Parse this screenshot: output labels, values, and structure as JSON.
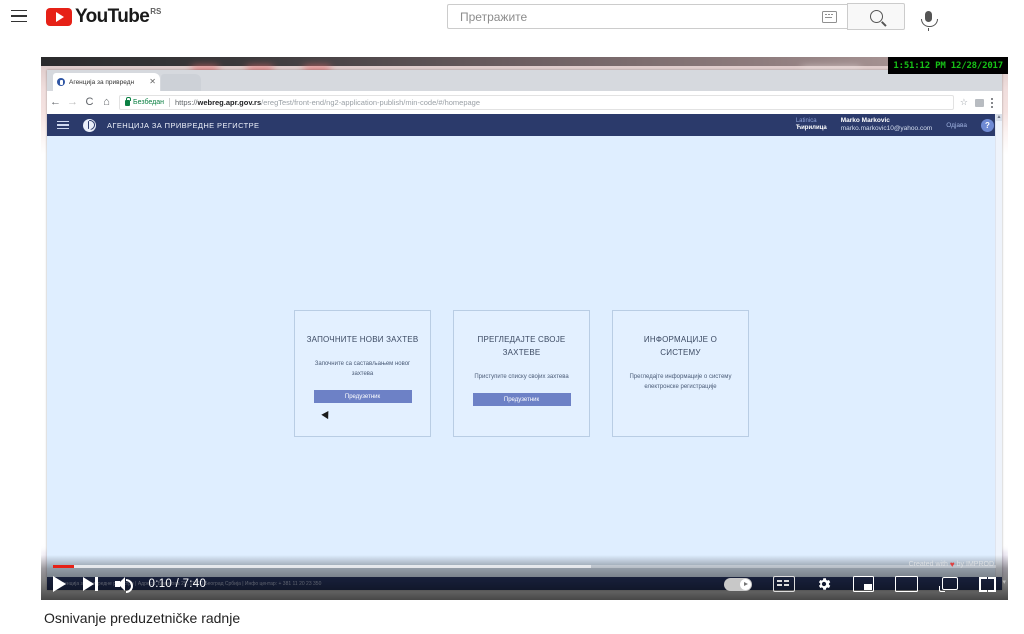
{
  "youtube": {
    "menu_icon": "hamburger-menu-icon",
    "logo_text": "YouTube",
    "country_code": "RS",
    "search": {
      "placeholder": "Претражите",
      "value": "",
      "keyboard_icon": "keyboard-icon",
      "search_icon": "search-icon"
    },
    "mic_icon": "microphone-icon"
  },
  "video": {
    "title": "Osnivanje preduzetničke radnje",
    "current_time": "0:10",
    "duration": "7:40",
    "time_display": "0:10 / 7:40",
    "progress_percent": 2.2,
    "buffered_percent": 57,
    "watermark": "Created with",
    "watermark_suffix": "by IMPROD",
    "controls": {
      "play": "play-button",
      "next": "next-video-button",
      "volume": "volume-button",
      "autoplay": "autoplay-toggle",
      "subtitles": "subtitles-button",
      "settings": "settings-gear-button",
      "miniplayer": "miniplayer-button",
      "theater": "theater-mode-button",
      "cast": "cast-button",
      "fullscreen": "fullscreen-button"
    }
  },
  "screen_overlay": {
    "timestamp": "1:51:12 PM 12/28/2017"
  },
  "browser": {
    "tab": {
      "title": "Агенција за привредн",
      "close_label": "✕"
    },
    "nav": {
      "back": "←",
      "forward": "→",
      "reload": "C",
      "home": "⌂"
    },
    "security_label": "Безбедан",
    "url": {
      "scheme": "https://",
      "domain": "webreg.apr.gov.rs",
      "path": "/eregTest/front-end/ng2-application-publish/min-code/#/homepage",
      "full": "https://webreg.apr.gov.rs/eregTest/front-end/ng2-application-publish/min-code/#/homepage"
    },
    "bookmark_icon": "star-icon",
    "extension_icon": "extension-icon",
    "menu_icon": "three-dot-menu-icon"
  },
  "app": {
    "header": {
      "menu_icon": "hamburger-menu-icon",
      "logo": "apr-logo-icon",
      "title": "АГЕНЦИЈА ЗА ПРИВРЕДНЕ РЕГИСТРЕ",
      "language": {
        "latin": "Latinica",
        "cyrillic": "Ћирилица"
      },
      "user": {
        "name": "Marko Markovic",
        "email": "marko.markovic10@yahoo.com"
      },
      "logout": "Одјава",
      "help_icon": "?"
    },
    "cards": [
      {
        "title": "ЗАПОЧНИТЕ НОВИ ЗАХТЕВ",
        "description": "Започните са састављањем новог захтева",
        "button": "Предузетник",
        "has_button": true
      },
      {
        "title": "ПРЕГЛЕДАЈТЕ СВОЈЕ ЗАХТЕВЕ",
        "description": "Приступите списку својих захтева",
        "button": "Предузетник",
        "has_button": true
      },
      {
        "title": "ИНФОРМАЦИЈЕ О СИСТЕМУ",
        "description": "Прегледајте информације о систему електронске регистрације",
        "button": "",
        "has_button": false
      }
    ],
    "footer": "Агенција за привредне регистре | Адреса: Бранкова 25, 11000 Београд Србија | Инфо центар: + 381 11 20 23 350"
  },
  "colors": {
    "youtube_red": "#e62117",
    "app_header_blue": "#2b3a6b",
    "app_bg_blue": "#dfeeff",
    "card_bg": "#e3f0ff",
    "button_blue": "#6d81c6",
    "secure_green": "#0b8043",
    "timestamp_green": "#17c217"
  }
}
